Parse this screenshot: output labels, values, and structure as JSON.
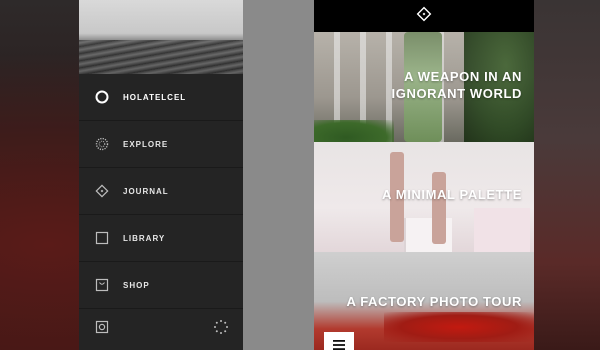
{
  "menu": {
    "items": [
      {
        "label": "HOLATELCEL",
        "icon": "circle-icon",
        "active": true
      },
      {
        "label": "EXPLORE",
        "icon": "dotted-circle-icon",
        "active": false
      },
      {
        "label": "JOURNAL",
        "icon": "diamond-icon",
        "active": false
      },
      {
        "label": "LIBRARY",
        "icon": "square-icon",
        "active": false
      },
      {
        "label": "SHOP",
        "icon": "shop-box-icon",
        "active": false
      }
    ],
    "footer": {
      "left_icon": "camera-icon",
      "right_icon": "loading-spinner-icon"
    }
  },
  "feed": {
    "logo_icon": "vsco-diamond-logo-icon",
    "cards": [
      {
        "title": "A WEAPON IN AN IGNORANT WORLD"
      },
      {
        "title": "A MINIMAL PALETTE"
      },
      {
        "title": "A FACTORY PHOTO TOUR"
      }
    ],
    "menu_button_icon": "hamburger-icon"
  },
  "colors": {
    "menu_bg": "#242424",
    "feed_bg": "#000000",
    "gap_panel": "#8a8a8a",
    "text_light": "#ffffff"
  }
}
